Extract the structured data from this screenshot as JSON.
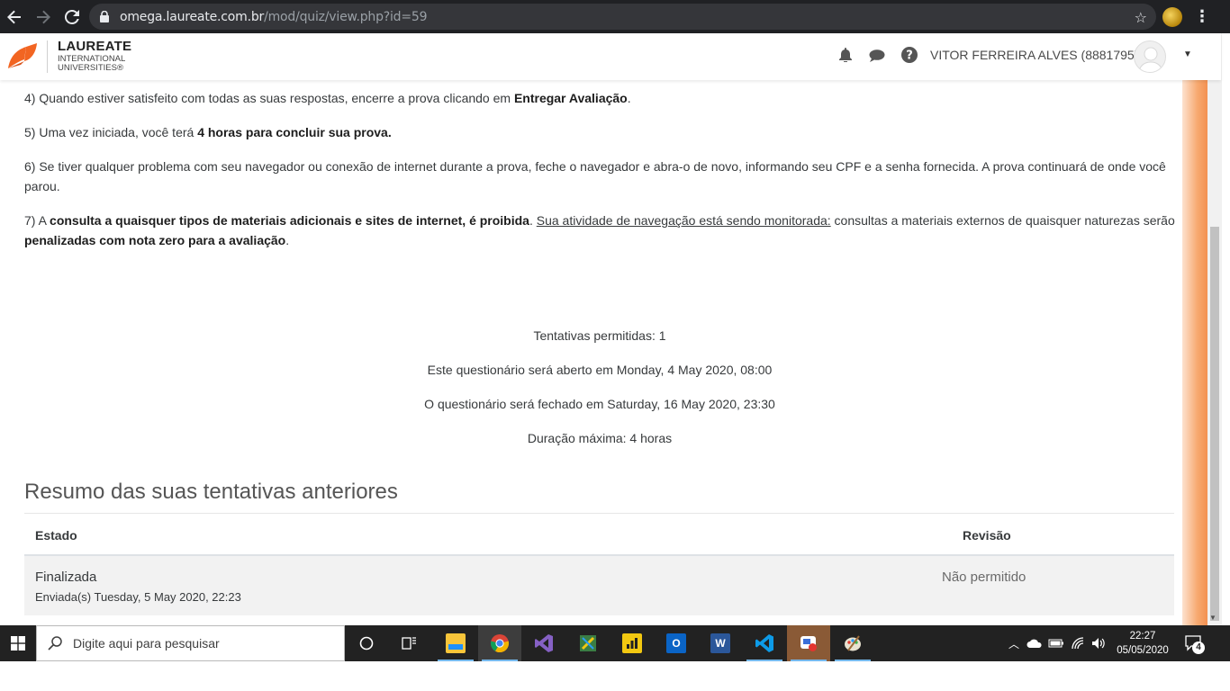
{
  "browser": {
    "url_domain": "omega.laureate.com.br",
    "url_path": "/mod/quiz/view.php?id=59"
  },
  "header": {
    "logo_title": "LAUREATE",
    "logo_sub1": "INTERNATIONAL",
    "logo_sub2": "UNIVERSITIES®",
    "user_name": "VITOR FERREIRA ALVES (8881795)"
  },
  "instructions": {
    "p4_a": "4) Quando estiver satisfeito com todas as suas respostas, encerre a prova clicando em ",
    "p4_b": "Entregar Avaliação",
    "p4_c": ".",
    "p5_a": "5) Uma vez iniciada, você terá ",
    "p5_b": "4 horas para concluir sua prova.",
    "p6": "6) Se tiver qualquer problema com seu navegador ou conexão de internet durante a prova, feche o navegador e abra-o de novo, informando seu CPF e a senha fornecida. A prova continuará de onde você parou.",
    "p7_a": "7) A ",
    "p7_b": "consulta a quaisquer tipos de materiais adicionais e sites de internet, é proibida",
    "p7_c": ". ",
    "p7_d": "Sua atividade de navegação está sendo monitorada:",
    "p7_e": " consultas a materiais externos de quaisquer naturezas serão ",
    "p7_f": "penalizadas com nota zero para a avaliação",
    "p7_g": "."
  },
  "quiz_info": {
    "attempts": "Tentativas permitidas: 1",
    "opens": "Este questionário será aberto em Monday, 4 May 2020, 08:00",
    "closes": "O questionário será fechado em Saturday, 16 May 2020, 23:30",
    "duration": "Duração máxima: 4 horas"
  },
  "summary": {
    "title": "Resumo das suas tentativas anteriores",
    "col_state": "Estado",
    "col_review": "Revisão",
    "rows": [
      {
        "state": "Finalizada",
        "submitted": "Enviada(s) Tuesday, 5 May 2020, 22:23",
        "review": "Não permitido"
      }
    ]
  },
  "taskbar": {
    "search_placeholder": "Digite aqui para pesquisar",
    "time": "22:27",
    "date": "05/05/2020",
    "notification_count": "4"
  },
  "colors": {
    "laureate_orange": "#f26522",
    "taskbar": "#222222",
    "chrome_dark": "#202124"
  }
}
